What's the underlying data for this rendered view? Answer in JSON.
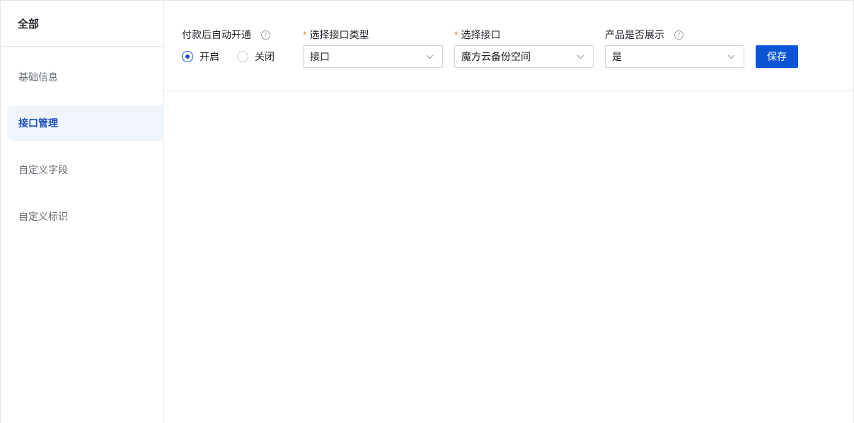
{
  "sidebar": {
    "header": "全部",
    "items": [
      {
        "label": "基础信息",
        "active": false
      },
      {
        "label": "接口管理",
        "active": true
      },
      {
        "label": "自定义字段",
        "active": false
      },
      {
        "label": "自定义标识",
        "active": false
      }
    ]
  },
  "form": {
    "auto_open": {
      "label": "付款后自动开通",
      "help_icon": "question-circle-icon",
      "options": [
        {
          "label": "开启",
          "checked": true
        },
        {
          "label": "关闭",
          "checked": false
        }
      ]
    },
    "interface_type": {
      "required_mark": "*",
      "label": "选择接口类型",
      "value": "接口"
    },
    "interface": {
      "required_mark": "*",
      "label": "选择接口",
      "value": "魔方云备份空间"
    },
    "product_display": {
      "label": "产品是否展示",
      "help_icon": "question-circle-icon",
      "value": "是"
    },
    "save_label": "保存"
  },
  "colors": {
    "primary": "#0a55d6",
    "active_nav_bg": "#f0f4fb",
    "active_nav_text": "#1d4fbf",
    "required": "#e0862b"
  }
}
